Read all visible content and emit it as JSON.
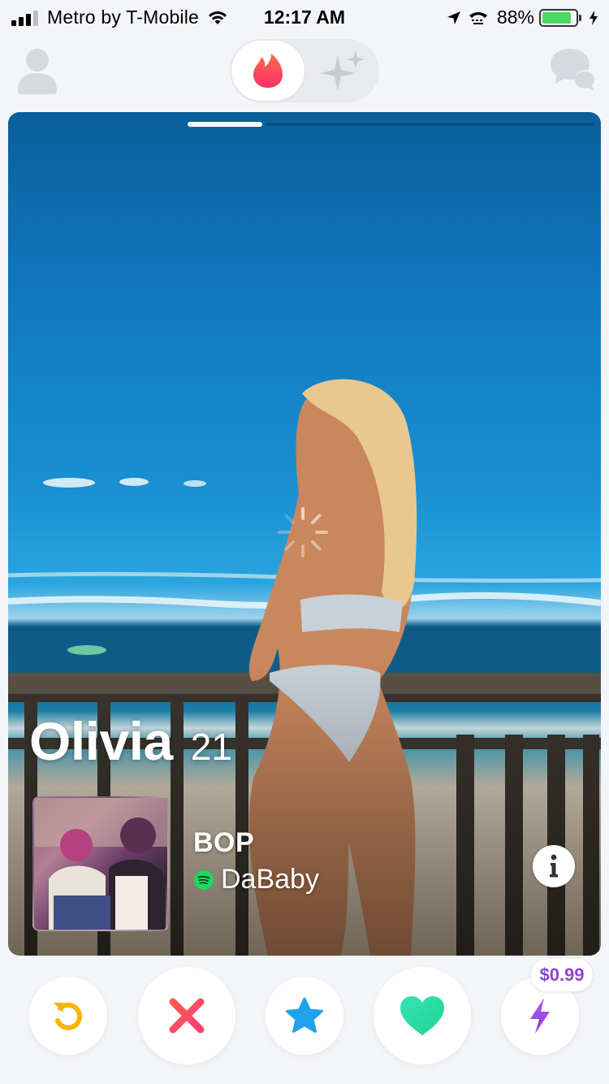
{
  "status_bar": {
    "carrier": "Metro by T-Mobile",
    "time": "12:17 AM",
    "battery_percent": "88%",
    "battery_level": 0.88
  },
  "top_nav": {
    "profile_icon": "person-icon",
    "active_tab_icon": "flame-icon",
    "other_tab_icon": "sparkles-icon",
    "chat_icon": "chat-bubbles-icon"
  },
  "card": {
    "name": "Olivia",
    "age": "21",
    "photo_index": 1,
    "photo_count": 5,
    "anthem": {
      "title": "BOP",
      "artist": "DaBaby",
      "service_icon": "spotify-icon"
    },
    "info_icon": "info-icon"
  },
  "actions": {
    "rewind_icon": "rewind-icon",
    "nope_icon": "x-icon",
    "super_like_icon": "star-icon",
    "like_icon": "heart-icon",
    "boost_icon": "lightning-icon",
    "boost_price": "$0.99"
  },
  "colors": {
    "brand_flame": "#fd3a60",
    "rewind": "#f7b500",
    "nope": "#fe4f63",
    "super_like": "#1fa3ea",
    "like": "#1fe2a5",
    "boost": "#a04ee0"
  }
}
